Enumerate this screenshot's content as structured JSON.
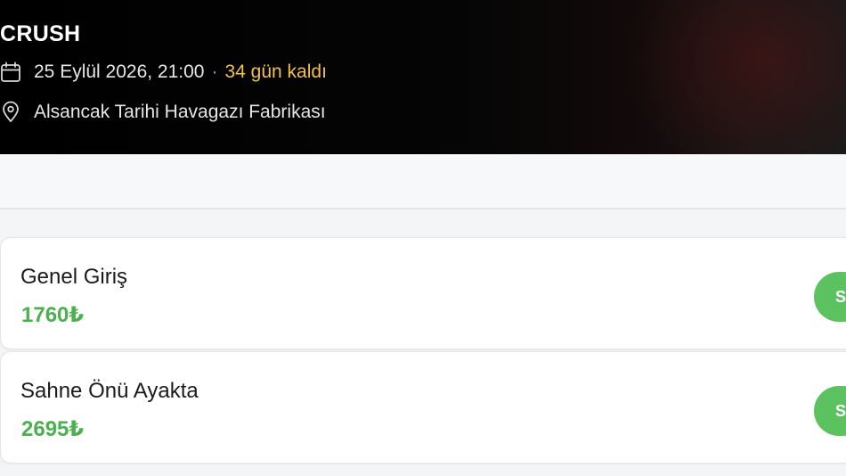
{
  "event": {
    "title": "CRUSH",
    "date_text": "25 Eylül 2026, 21:00",
    "separator": "·",
    "countdown": "34 gün kaldı",
    "venue": "Alsancak Tarihi Havagazı Fabrikası",
    "icons": {
      "date": "calendar-icon",
      "venue": "location-pin-icon"
    }
  },
  "tickets": [
    {
      "name": "Genel Giriş",
      "price": "1760₺",
      "button_label": "S"
    },
    {
      "name": "Sahne Önü Ayakta",
      "price": "2695₺",
      "button_label": "S"
    }
  ],
  "colors": {
    "price": "#4caf50",
    "countdown": "#f2c14e",
    "button": "#5cc15f"
  }
}
